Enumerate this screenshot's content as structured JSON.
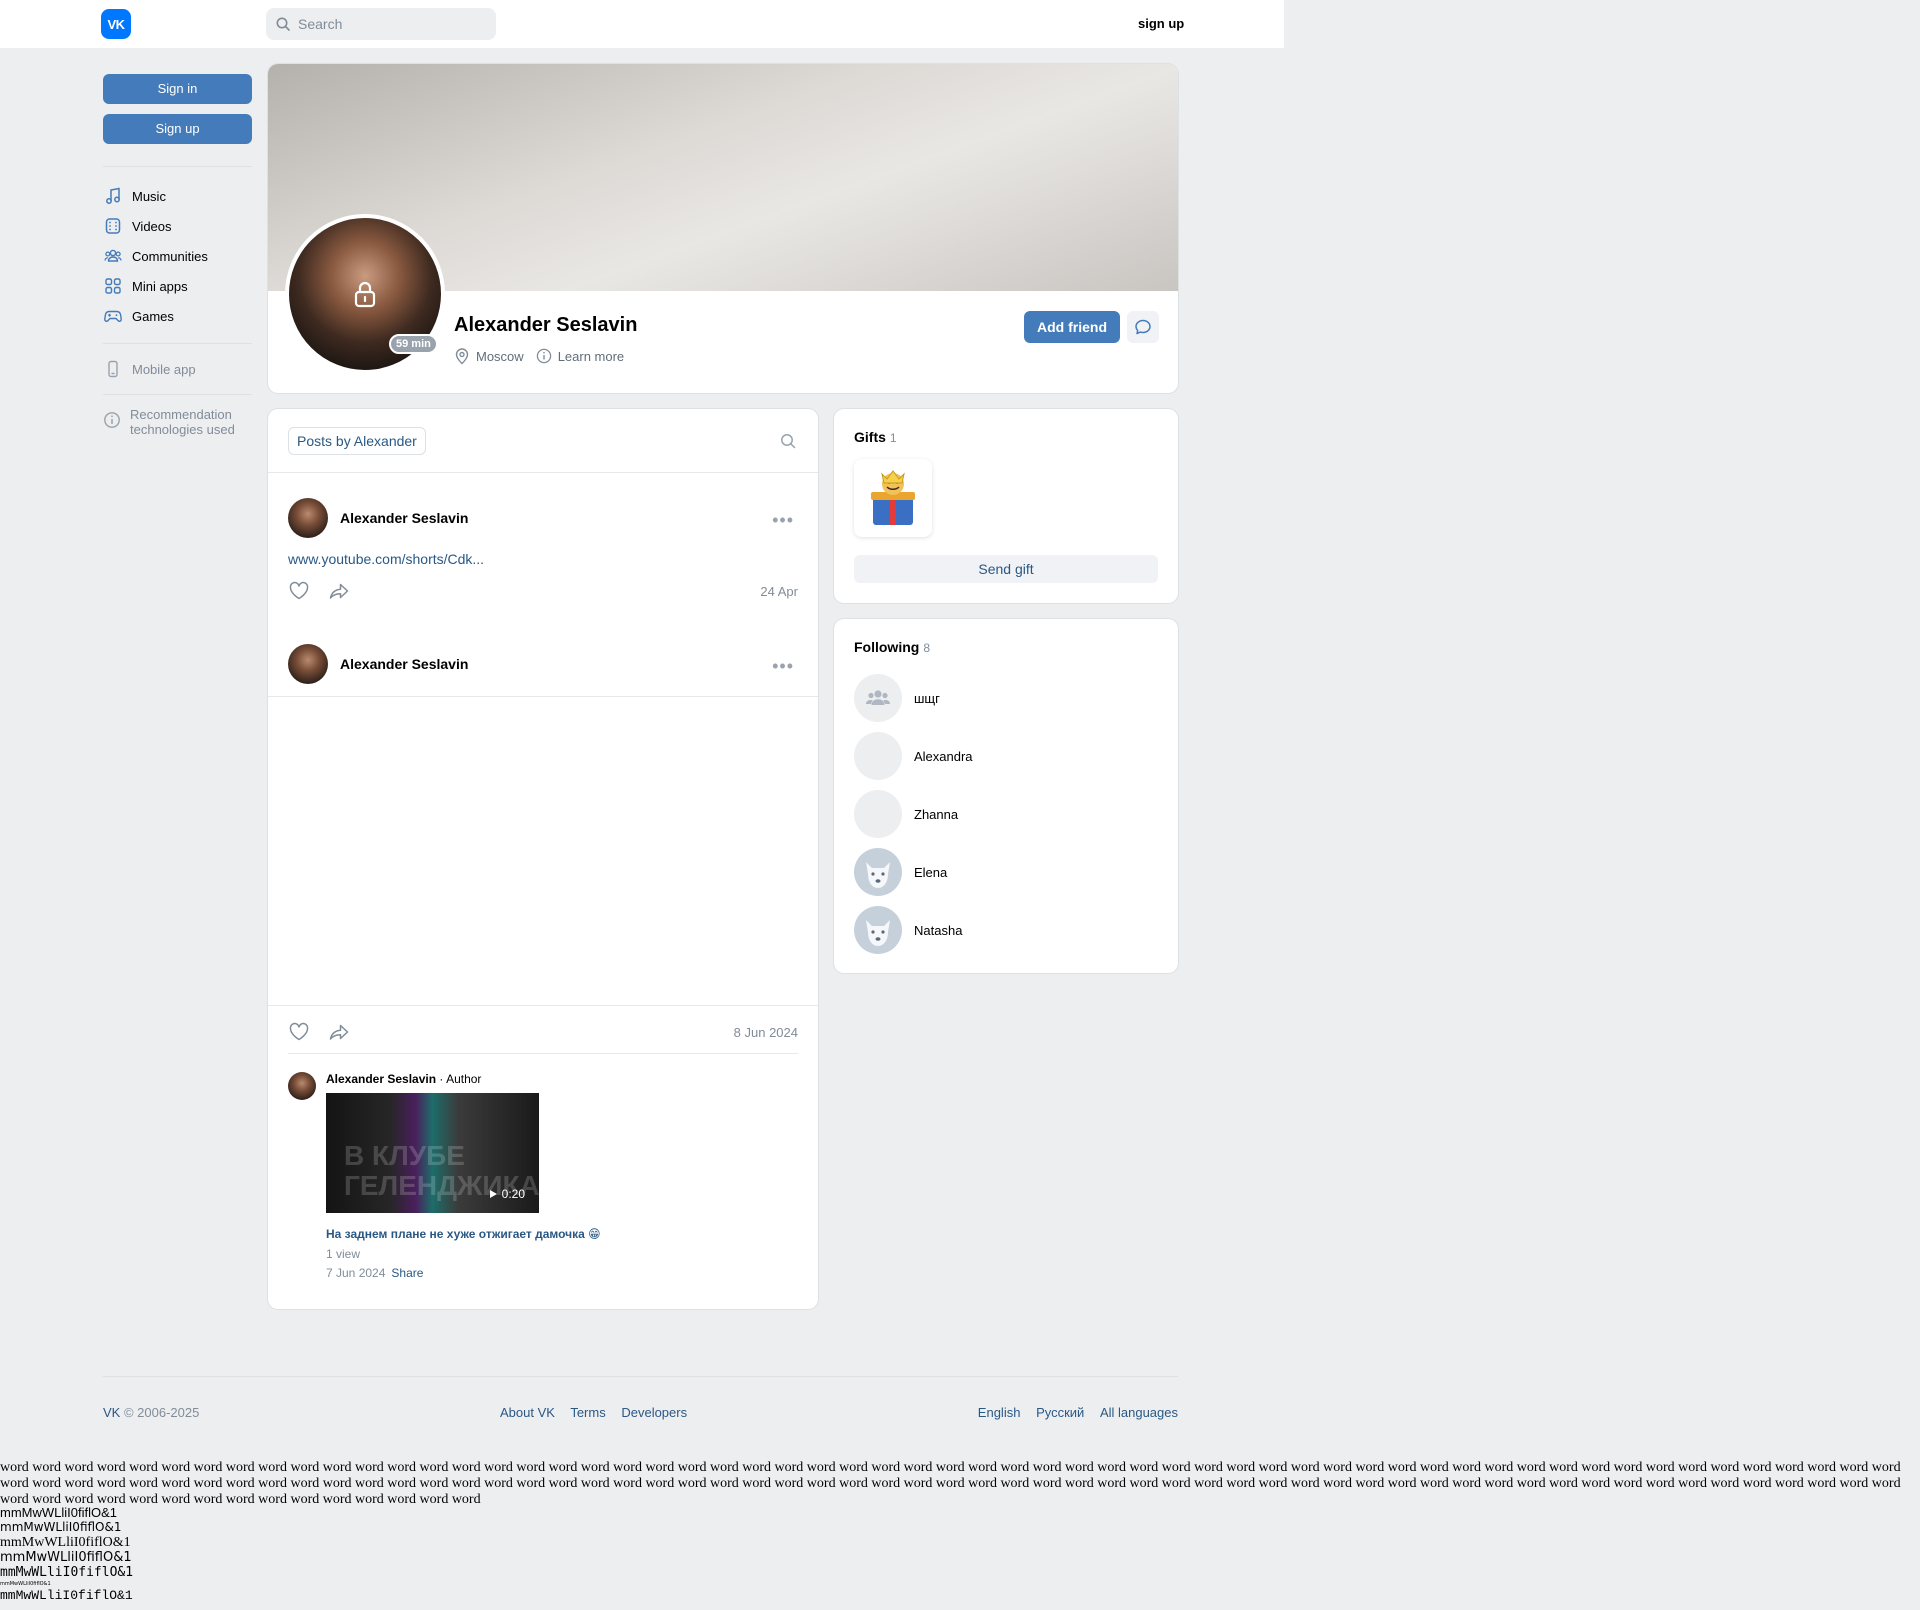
{
  "header": {
    "logo_text": "VK",
    "search_placeholder": "Search",
    "signup_label": "sign up"
  },
  "leftnav": {
    "sign_in": "Sign in",
    "sign_up": "Sign up",
    "items": [
      {
        "label": "Music",
        "icon": "music-icon"
      },
      {
        "label": "Videos",
        "icon": "videos-icon"
      },
      {
        "label": "Communities",
        "icon": "communities-icon"
      },
      {
        "label": "Mini apps",
        "icon": "mini-apps-icon"
      },
      {
        "label": "Games",
        "icon": "games-icon"
      }
    ],
    "mobile_app": "Mobile app",
    "recommendation": "Recommendation technologies used"
  },
  "profile": {
    "name": "Alexander Seslavin",
    "online": "59 min",
    "city": "Moscow",
    "learn_more": "Learn more",
    "add_friend": "Add friend"
  },
  "wall": {
    "tab": "Posts by Alexander",
    "posts": [
      {
        "author": "Alexander Seslavin",
        "link": "www.youtube.com/shorts/Cdk...",
        "date": "24 Apr"
      },
      {
        "author": "Alexander Seslavin",
        "date": "8 Jun 2024"
      }
    ],
    "comment": {
      "author": "Alexander Seslavin",
      "role": " · Author",
      "video_text": "В КЛУБЕ ГЕЛЕНДЖИКА",
      "duration": "0:20",
      "title": "На заднем плане не хуже отжигает дамочка 😁",
      "views": "1 view",
      "date": "7 Jun 2024",
      "share": "Share"
    }
  },
  "gifts": {
    "title": "Gifts",
    "count": "1",
    "send": "Send gift"
  },
  "following": {
    "title": "Following",
    "count": "8",
    "items": [
      {
        "name": "шщг",
        "avatar": "community-icon"
      },
      {
        "name": "Alexandra",
        "avatar": "empty"
      },
      {
        "name": "Zhanna",
        "avatar": "empty"
      },
      {
        "name": "Elena",
        "avatar": "dog-icon"
      },
      {
        "name": "Natasha",
        "avatar": "dog-icon"
      }
    ]
  },
  "footer": {
    "brand": "VK",
    "copyright": " © 2006-2025",
    "about": "About VK",
    "terms": "Terms",
    "developers": "Developers",
    "english": "English",
    "russian": "Русский",
    "all_languages": "All languages"
  },
  "test_text": {
    "words": "word word word word word word word word word word word word word word word word word word word word word word word word word word word word word word word word word word word word word word word word word word word word word word word word word word word word word word word word word word word word word word word word word word word word word word word word word word word word word word word word word word word word word word word word word word word word word word word word word word word word word word word word word word word word word word word word word word word word word word word word word word word word word word word word word word word word word",
    "glyph_1": "mmMwWLliI0fiflO&1",
    "glyph_2": "mmMwWLliI0fiflO&1",
    "glyph_3": "mmMwWLliI0fiflO&1",
    "glyph_4": "mmMwWLliI0fiflO&1",
    "glyph_5": "mmMwWLliI0fiflO&1",
    "glyph_6": "mmMwWLliI0fiflO&1",
    "glyph_7": "mmMwWLliI0fiflO&1"
  },
  "colors": {
    "accent": "#447bba",
    "link": "#2a5885",
    "background": "#edeef0",
    "brand": "#0077ff"
  }
}
